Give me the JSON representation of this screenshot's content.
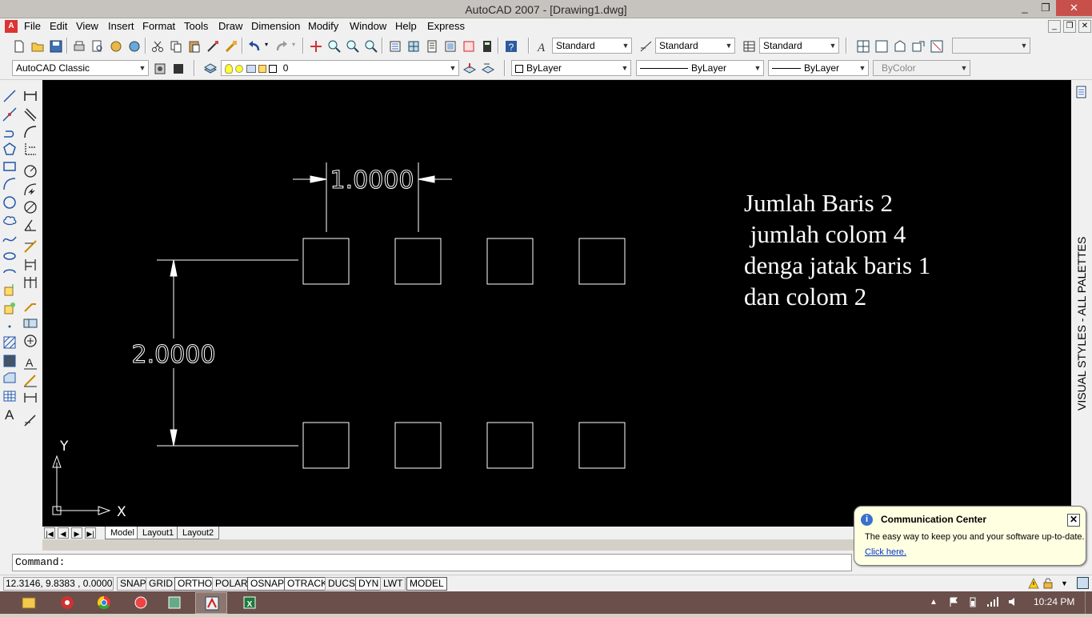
{
  "window": {
    "title": "AutoCAD 2007 - [Drawing1.dwg]",
    "controls": [
      "_",
      "❐",
      "✕"
    ],
    "doc_controls": [
      "_",
      "❐",
      "✕"
    ]
  },
  "menu": [
    "File",
    "Edit",
    "View",
    "Insert",
    "Format",
    "Tools",
    "Draw",
    "Dimension",
    "Modify",
    "Window",
    "Help",
    "Express"
  ],
  "toolbar1": {
    "text_style": "Standard",
    "dim_style": "Standard",
    "table_style": "Standard"
  },
  "toolbar2": {
    "workspace": "AutoCAD Classic",
    "layer": "0",
    "color": "ByLayer",
    "linetype": "ByLayer",
    "lineweight": "ByLayer",
    "plotstyle": "ByColor"
  },
  "drawing": {
    "dim_horizontal": "1.0000",
    "dim_vertical": "2.0000",
    "note_lines": [
      "Jumlah Baris 2",
      " jumlah colom 4",
      "denga jatak baris 1",
      "dan colom 2"
    ],
    "ucs_x": "X",
    "ucs_y": "Y",
    "array_rows": 2,
    "array_columns": 4
  },
  "right_palette_label": "VISUAL STYLES - ALL PALETTES",
  "layout_tabs": [
    "Model",
    "Layout1",
    "Layout2"
  ],
  "command": {
    "prompt": "Command:"
  },
  "status": {
    "coords": "12.3146, 9.8383 , 0.0000",
    "toggles": [
      "SNAP",
      "GRID",
      "ORTHO",
      "POLAR",
      "OSNAP",
      "OTRACK",
      "DUCS",
      "DYN",
      "LWT",
      "MODEL"
    ]
  },
  "balloon": {
    "title": "Communication Center",
    "message": "The easy way to keep you and your software up-to-date.",
    "link": "Click here.",
    "close": "✕",
    "info": "i"
  },
  "taskbar": {
    "time": "10:24 PM"
  }
}
